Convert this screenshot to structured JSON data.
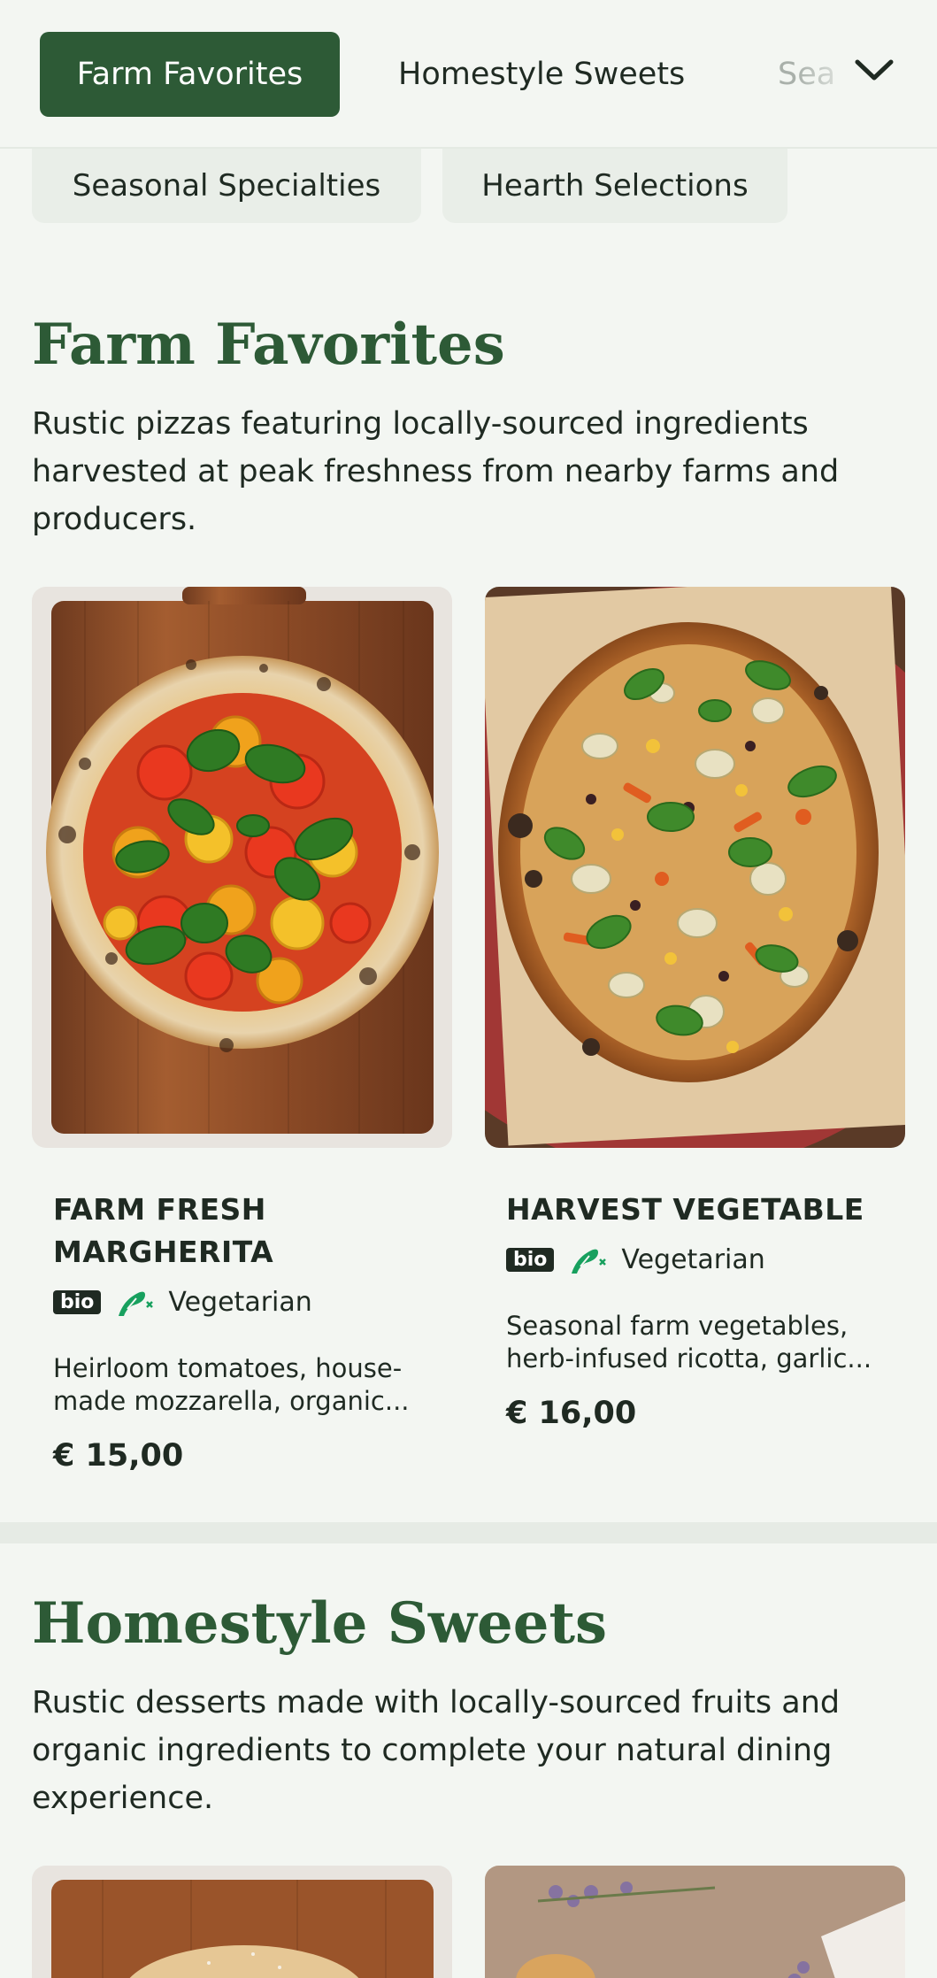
{
  "tabs": {
    "active": "Farm Favorites",
    "second": "Homestyle Sweets",
    "third": "Sea",
    "chips": [
      "Seasonal Specialties",
      "Hearth Selections"
    ]
  },
  "sections": [
    {
      "title": "Farm Favorites",
      "description": "Rustic pizzas featuring locally-sourced ingredients harvested at peak freshness from nearby farms and producers.",
      "items": [
        {
          "title_line1": "FARM FRESH",
          "title_line2": "MARGHERITA",
          "badge": "bio",
          "diet": "Vegetarian",
          "desc_line1": "Heirloom tomatoes, house-",
          "desc_line2": "made mozzarella, organic...",
          "price": "€ 15,00"
        },
        {
          "title_line1": "HARVEST VEGETABLE",
          "badge": "bio",
          "diet": "Vegetarian",
          "desc_line1": "Seasonal farm vegetables,",
          "desc_line2": "herb-infused ricotta, garlic...",
          "price": "€ 16,00"
        }
      ]
    },
    {
      "title": "Homestyle Sweets",
      "description": "Rustic desserts made with locally-sourced fruits and organic ingredients to complete your natural dining experience."
    }
  ],
  "colors": {
    "brand": "#2d5a36",
    "background": "#f3f6f2",
    "veg_icon": "#17a05e"
  },
  "icons": [
    "chevron-down-icon",
    "vegetarian-icon"
  ]
}
